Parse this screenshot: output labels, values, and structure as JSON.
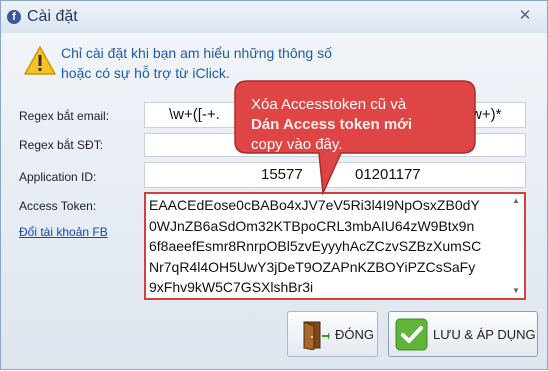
{
  "window": {
    "title": "Cài đặt",
    "app_icon": "f",
    "close_glyph": "✕"
  },
  "warning": {
    "line1": "Chỉ cài đặt khi bạn am hiểu những thông số",
    "line2": "hoặc có sự hỗ trợ từ iClick."
  },
  "form": {
    "email_label": "Regex bắt email:",
    "email_value_left": "\\w+([-+.",
    "email_value_right": "w+)*",
    "phone_label": "Regex bắt SĐT:",
    "phone_value": "",
    "appid_label": "Application ID:",
    "appid_value_left": "15577",
    "appid_value_right": "01201177",
    "token_label": "Access Token:",
    "switch_account_link": "Đổi tài khoản FB",
    "token_lines": [
      "EAACEdEose0cBABo4xJV7eV5Ri3l4I9NpOsxZB0dY",
      "0WJnZB6aSdOm32KTBpoCRL3mbAIU64zW9Btx9n",
      "6f8aeefEsmr8RnrpOBl5zvEyyyhAcZCzvSZBzXumSC",
      "Nr7qR4l4OH5UwY3jDeT9OZAPnKZBOYiPZCsSaFy",
      "9xFhv9kW5C7GSXlshBr3i"
    ]
  },
  "callout": {
    "line1": "Xóa Accesstoken cũ và",
    "line2": "Dán Access token mới",
    "line3": "copy vào đây.",
    "fill_color": "#e04545",
    "border_color": "#a82b2b"
  },
  "buttons": {
    "close_label": "ĐÓNG",
    "save_label": "LƯU & ÁP DỤNG"
  },
  "icons": {
    "title": "facebook-icon",
    "warning": "warning-icon",
    "close_button": "door-exit-icon",
    "save_button": "checkmark-icon"
  }
}
